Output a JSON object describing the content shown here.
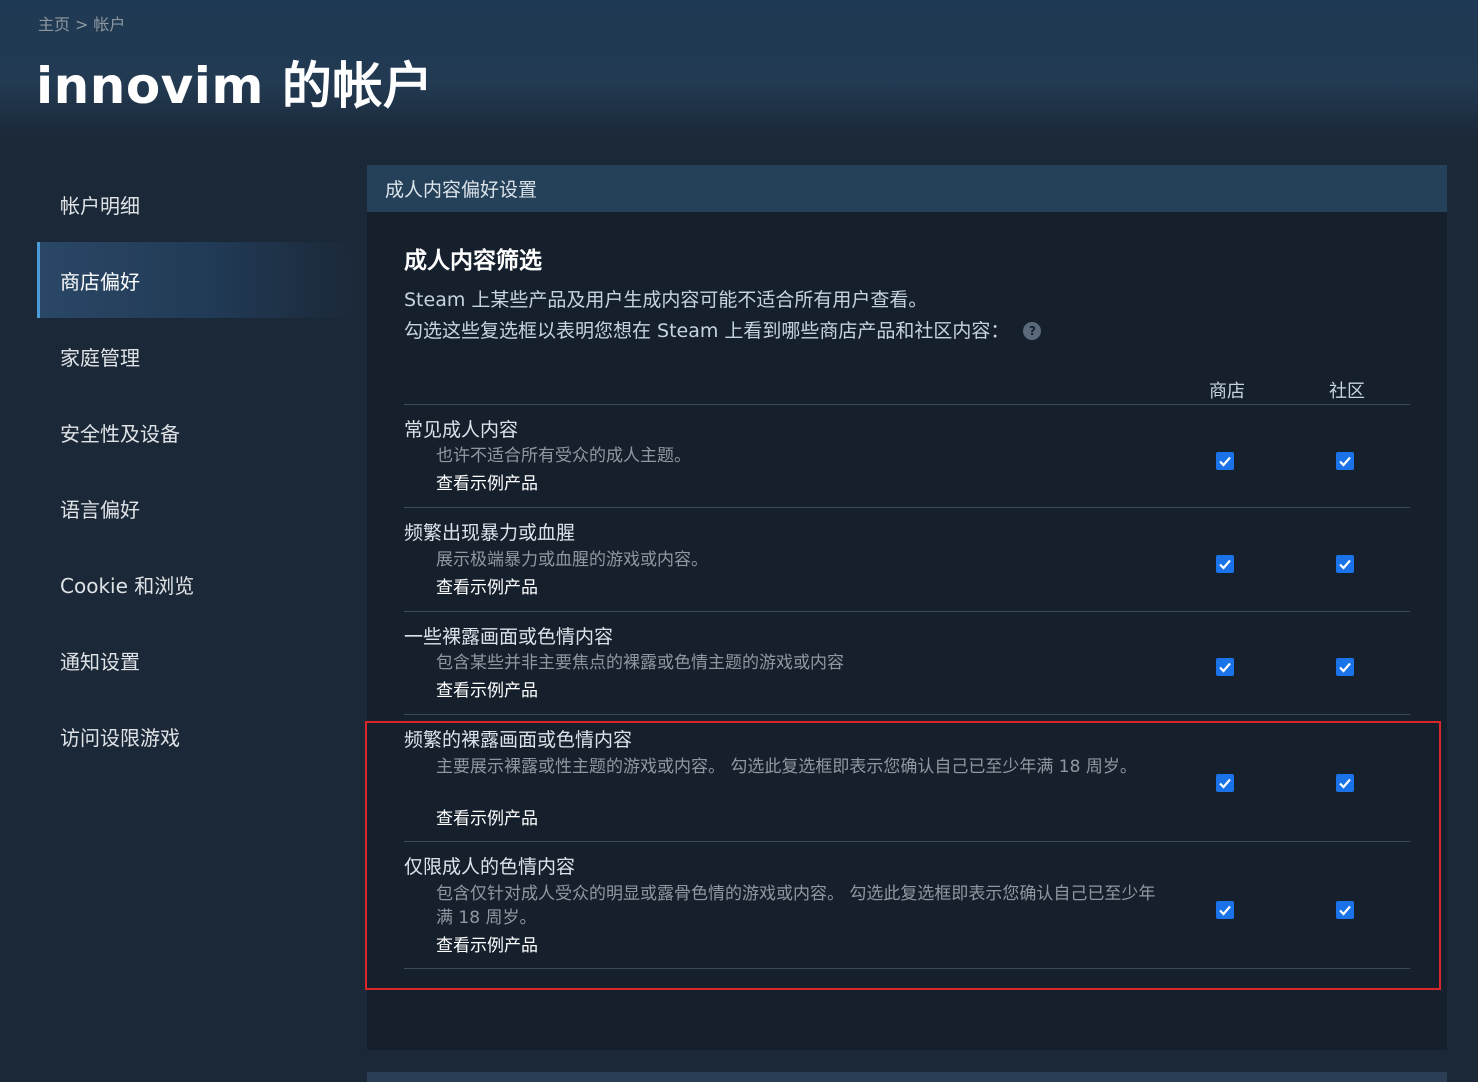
{
  "breadcrumb": {
    "home": "主页",
    "separator": ">",
    "current": "帐户"
  },
  "page_title": "innovim 的帐户",
  "sidebar": {
    "items": [
      {
        "label": "帐户明细",
        "active": false
      },
      {
        "label": "商店偏好",
        "active": true
      },
      {
        "label": "家庭管理",
        "active": false
      },
      {
        "label": "安全性及设备",
        "active": false
      },
      {
        "label": "语言偏好",
        "active": false
      },
      {
        "label": "Cookie 和浏览",
        "active": false
      },
      {
        "label": "通知设置",
        "active": false
      },
      {
        "label": "访问设限游戏",
        "active": false
      }
    ]
  },
  "panel": {
    "header": "成人内容偏好设置",
    "section_title": "成人内容筛选",
    "desc_line1": "Steam 上某些产品及用户生成内容可能不适合所有用户查看。",
    "desc_line2": "勾选这些复选框以表明您想在 Steam 上看到哪些商店产品和社区内容：",
    "help_icon_glyph": "?",
    "col_store": "商店",
    "col_community": "社区",
    "rows": [
      {
        "title": "常见成人内容",
        "desc": "也许不适合所有受众的成人主题。",
        "link": "查看示例产品",
        "store": true,
        "community": true
      },
      {
        "title": "频繁出现暴力或血腥",
        "desc": "展示极端暴力或血腥的游戏或内容。",
        "link": "查看示例产品",
        "store": true,
        "community": true
      },
      {
        "title": "一些裸露画面或色情内容",
        "desc": "包含某些并非主要焦点的裸露或色情主题的游戏或内容",
        "link": "查看示例产品",
        "store": true,
        "community": true
      },
      {
        "title": "频繁的裸露画面或色情内容",
        "desc": "主要展示裸露或性主题的游戏或内容。 勾选此复选框即表示您确认自己已至少年满 18 周岁。",
        "link": "查看示例产品",
        "store": true,
        "community": true
      },
      {
        "title": "仅限成人的色情内容",
        "desc": "包含仅针对成人受众的明显或露骨色情的游戏或内容。 勾选此复选框即表示您确认自己已至少年满 18 周岁。",
        "link": "查看示例产品",
        "store": true,
        "community": true
      }
    ]
  },
  "colors": {
    "checkbox": "#1a73e8",
    "highlight": "#d9262b",
    "accent": "#4c9bd9"
  },
  "icons": {
    "help": "question-circle-icon",
    "check": "checkmark-icon"
  }
}
